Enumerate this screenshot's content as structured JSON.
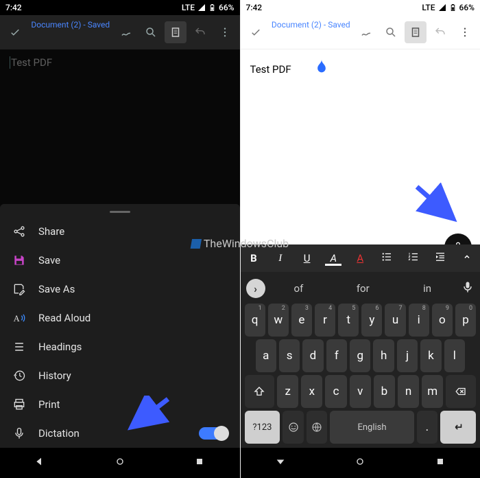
{
  "statusbar": {
    "time": "7:42",
    "net": "LTE",
    "battery": "66%"
  },
  "header": {
    "doc_title": "Document (2) - Saved"
  },
  "document": {
    "text": "Test PDF"
  },
  "menu": {
    "share": "Share",
    "save": "Save",
    "save_as": "Save As",
    "read_aloud": "Read Aloud",
    "headings": "Headings",
    "history": "History",
    "print": "Print",
    "dictation": "Dictation",
    "dictation_enabled": true
  },
  "format_toolbar": {
    "bold": "B",
    "italic": "I",
    "underline": "U",
    "highlight": "A",
    "color": "A"
  },
  "suggestions": {
    "s1": "of",
    "s2": "for",
    "s3": "in"
  },
  "keyboard": {
    "row1": [
      {
        "k": "q",
        "s": "1"
      },
      {
        "k": "w",
        "s": "2"
      },
      {
        "k": "e",
        "s": "3"
      },
      {
        "k": "r",
        "s": "4"
      },
      {
        "k": "t",
        "s": "5"
      },
      {
        "k": "y",
        "s": "6"
      },
      {
        "k": "u",
        "s": "7"
      },
      {
        "k": "i",
        "s": "8"
      },
      {
        "k": "o",
        "s": "9"
      },
      {
        "k": "p",
        "s": "0"
      }
    ],
    "row2": [
      "a",
      "s",
      "d",
      "f",
      "g",
      "h",
      "j",
      "k",
      "l"
    ],
    "row3": [
      "z",
      "x",
      "c",
      "v",
      "b",
      "n",
      "m"
    ],
    "symbols": "?123",
    "space": "English",
    "period": "."
  },
  "watermark": "TheWindowsClub"
}
